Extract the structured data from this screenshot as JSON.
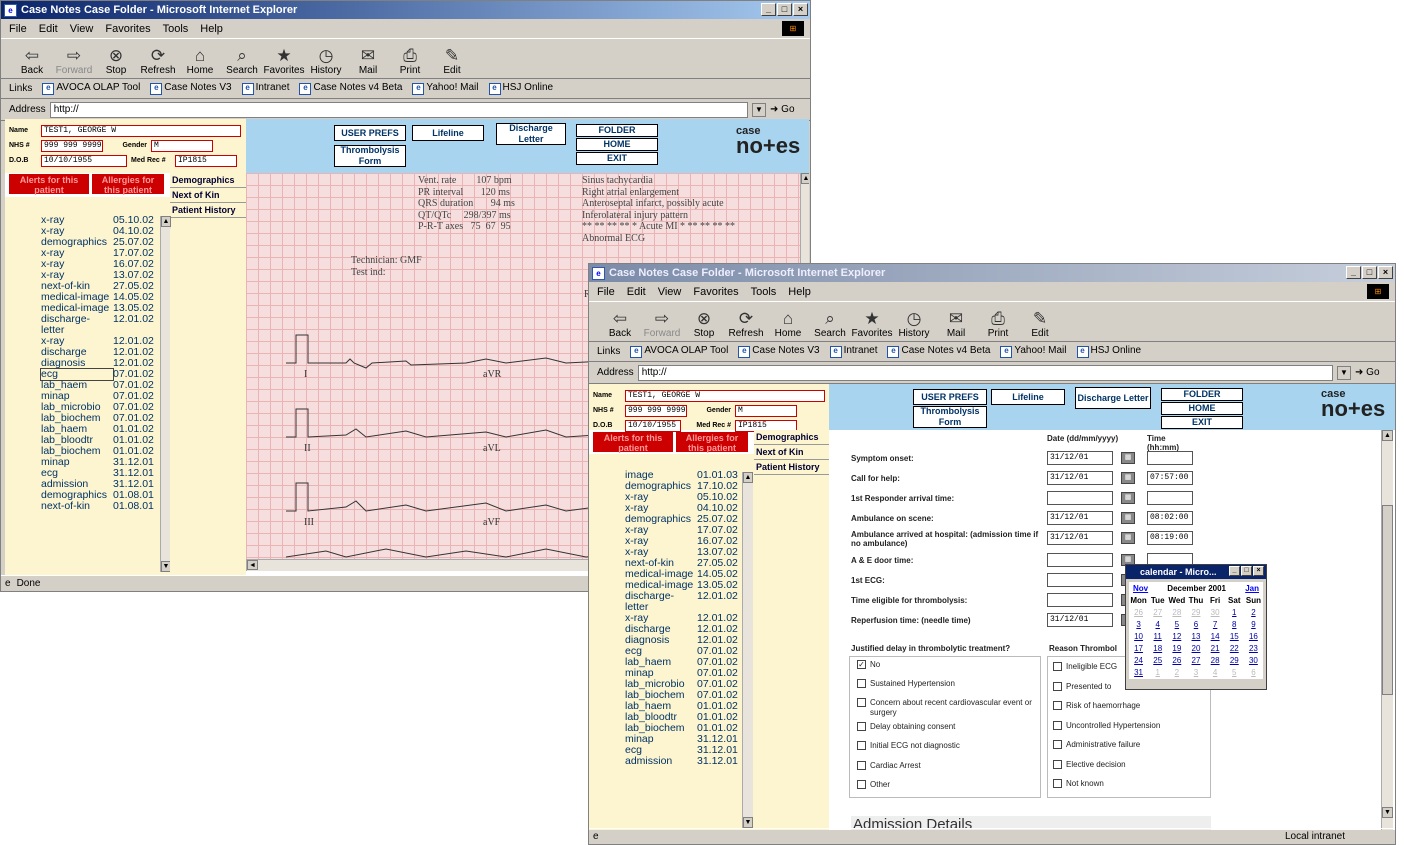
{
  "window1": {
    "title": "Case Notes Case Folder - Microsoft Internet Explorer",
    "menu": [
      "File",
      "Edit",
      "View",
      "Favorites",
      "Tools",
      "Help"
    ],
    "toolbar": [
      "Back",
      "Forward",
      "Stop",
      "Refresh",
      "Home",
      "Search",
      "Favorites",
      "History",
      "Mail",
      "Print",
      "Edit"
    ],
    "links_label": "Links",
    "links": [
      "AVOCA OLAP Tool",
      "Case Notes V3",
      "Intranet",
      "Case Notes v4 Beta",
      "Yahoo! Mail",
      "HSJ Online"
    ],
    "address_label": "Address",
    "address": "http://",
    "go": "Go",
    "status": "Done"
  },
  "window2": {
    "title": "Case Notes Case Folder - Microsoft Internet Explorer",
    "menu": [
      "File",
      "Edit",
      "View",
      "Favorites",
      "Tools",
      "Help"
    ],
    "toolbar": [
      "Back",
      "Forward",
      "Stop",
      "Refresh",
      "Home",
      "Search",
      "Favorites",
      "History",
      "Mail",
      "Print",
      "Edit"
    ],
    "links_label": "Links",
    "links": [
      "AVOCA OLAP Tool",
      "Case Notes V3",
      "Intranet",
      "Case Notes v4 Beta",
      "Yahoo! Mail",
      "HSJ Online"
    ],
    "address_label": "Address",
    "address": "http://",
    "go": "Go",
    "status_zone": "Local intranet"
  },
  "patient": {
    "name_label": "Name",
    "name": "TEST1, GEORGE W",
    "nhs_label": "NHS #",
    "nhs": "999 999 9999",
    "gender_label": "Gender",
    "gender": "M",
    "dob_label": "D.O.B",
    "dob": "10/10/1955",
    "medrec_label": "Med Rec #",
    "medrec": "IP1815"
  },
  "banner": {
    "user_prefs": "USER PREFS",
    "lifeline": "Lifeline",
    "discharge": "Discharge Letter",
    "thrombolysis": "Thrombolysis Form",
    "folder": "FOLDER",
    "home": "HOME",
    "exit": "EXIT",
    "logo_top": "case",
    "logo_bottom": "no+es"
  },
  "alerts": {
    "alerts": "Alerts for this patient",
    "allergies": "Allergies for this patient"
  },
  "tabs": [
    "Demographics",
    "Next of Kin",
    "Patient History"
  ],
  "history1": [
    [
      "x-ray",
      "05.10.02"
    ],
    [
      "x-ray",
      "04.10.02"
    ],
    [
      "demographics",
      "25.07.02"
    ],
    [
      "x-ray",
      "17.07.02"
    ],
    [
      "x-ray",
      "16.07.02"
    ],
    [
      "x-ray",
      "13.07.02"
    ],
    [
      "next-of-kin",
      "27.05.02"
    ],
    [
      "medical-image",
      "14.05.02"
    ],
    [
      "medical-image",
      "13.05.02"
    ],
    [
      "discharge-letter",
      "12.01.02"
    ],
    [
      "x-ray",
      "12.01.02"
    ],
    [
      "discharge",
      "12.01.02"
    ],
    [
      "diagnosis",
      "12.01.02"
    ],
    [
      "ecg",
      "07.01.02"
    ],
    [
      "lab_haem",
      "07.01.02"
    ],
    [
      "minap",
      "07.01.02"
    ],
    [
      "lab_microbio",
      "07.01.02"
    ],
    [
      "lab_biochem",
      "07.01.02"
    ],
    [
      "lab_haem",
      "01.01.02"
    ],
    [
      "lab_bloodtr",
      "01.01.02"
    ],
    [
      "lab_biochem",
      "01.01.02"
    ],
    [
      "minap",
      "31.12.01"
    ],
    [
      "ecg",
      "31.12.01"
    ],
    [
      "admission",
      "31.12.01"
    ],
    [
      "demographics",
      "01.08.01"
    ],
    [
      "next-of-kin",
      "01.08.01"
    ]
  ],
  "history2": [
    [
      "image",
      "01.01.03"
    ],
    [
      "demographics",
      "17.10.02"
    ],
    [
      "x-ray",
      "05.10.02"
    ],
    [
      "x-ray",
      "04.10.02"
    ],
    [
      "demographics",
      "25.07.02"
    ],
    [
      "x-ray",
      "17.07.02"
    ],
    [
      "x-ray",
      "16.07.02"
    ],
    [
      "x-ray",
      "13.07.02"
    ],
    [
      "next-of-kin",
      "27.05.02"
    ],
    [
      "medical-image",
      "14.05.02"
    ],
    [
      "medical-image",
      "13.05.02"
    ],
    [
      "discharge-letter",
      "12.01.02"
    ],
    [
      "x-ray",
      "12.01.02"
    ],
    [
      "discharge",
      "12.01.02"
    ],
    [
      "diagnosis",
      "12.01.02"
    ],
    [
      "ecg",
      "07.01.02"
    ],
    [
      "lab_haem",
      "07.01.02"
    ],
    [
      "minap",
      "07.01.02"
    ],
    [
      "lab_microbio",
      "07.01.02"
    ],
    [
      "lab_biochem",
      "07.01.02"
    ],
    [
      "lab_haem",
      "01.01.02"
    ],
    [
      "lab_bloodtr",
      "01.01.02"
    ],
    [
      "lab_biochem",
      "01.01.02"
    ],
    [
      "minap",
      "31.12.01"
    ],
    [
      "ecg",
      "31.12.01"
    ],
    [
      "admission",
      "31.12.01"
    ]
  ],
  "ecg": {
    "measures": "Vent. rate        107 bpm\nPR interval       120 ms\nQRS duration       94 ms\nQT/QTc     298/397 ms\nP-R-T axes   75  67  95",
    "interp": "Sinus tachycardia\nRight atrial enlargement\nAnteroseptal infarct, possibly acute\nInferolateral injury pattern\n** ** ** ** * Acute MI * ** ** ** **\nAbnormal ECG",
    "tech": "Technician: GMF\nTest ind:",
    "leads": [
      "I",
      "aVR",
      "II",
      "aVL",
      "III",
      "aVF",
      "R"
    ]
  },
  "form": {
    "date_header": "Date (dd/mm/yyyy)",
    "time_header": "Time (hh:mm)",
    "rows": [
      {
        "label": "Symptom onset:",
        "date": "31/12/01",
        "time": ""
      },
      {
        "label": "Call for help:",
        "date": "31/12/01",
        "time": "07:57:00"
      },
      {
        "label": "1st Responder arrival time:",
        "date": "",
        "time": ""
      },
      {
        "label": "Ambulance on scene:",
        "date": "31/12/01",
        "time": "08:02:00"
      },
      {
        "label": "Ambulance arrived at hospital: (admission time if no ambulance)",
        "date": "31/12/01",
        "time": "08:19:00"
      },
      {
        "label": "A & E door time:",
        "date": "",
        "time": ""
      },
      {
        "label": "1st ECG:",
        "date": "",
        "time": ""
      },
      {
        "label": "Time eligible for thrombolysis:",
        "date": "",
        "time": ""
      },
      {
        "label": "Reperfusion time: (needle time)",
        "date": "31/12/01",
        "time": ""
      }
    ],
    "justified_q": "Justified delay in thrombolytic treatment?",
    "reason_q": "Reason Thrombol",
    "left_opts": [
      [
        "No",
        true
      ],
      [
        "Sustained Hypertension",
        false
      ],
      [
        "Concern about recent cardiovascular event or surgery",
        false
      ],
      [
        "Delay obtaining consent",
        false
      ],
      [
        "Initial ECG not diagnostic",
        false
      ],
      [
        "Cardiac Arrest",
        false
      ],
      [
        "Other",
        false
      ]
    ],
    "right_opts": [
      "Ineligible ECG",
      "Presented to",
      "Risk of haemorrhage",
      "Uncontrolled Hypertension",
      "Administrative failure",
      "Elective decision",
      "Not known"
    ],
    "admission_details": "Admission Details"
  },
  "calendar": {
    "title": "calendar - Micro...",
    "prev": "Nov",
    "month": "December 2001",
    "next": "Jan",
    "days": [
      "Mon",
      "Tue",
      "Wed",
      "Thu",
      "Fri",
      "Sat",
      "Sun"
    ],
    "weeks": [
      [
        "26",
        "27",
        "28",
        "29",
        "30",
        "1",
        "2"
      ],
      [
        "3",
        "4",
        "5",
        "6",
        "7",
        "8",
        "9"
      ],
      [
        "10",
        "11",
        "12",
        "13",
        "14",
        "15",
        "16"
      ],
      [
        "17",
        "18",
        "19",
        "20",
        "21",
        "22",
        "23"
      ],
      [
        "24",
        "25",
        "26",
        "27",
        "28",
        "29",
        "30"
      ],
      [
        "31",
        "1",
        "2",
        "3",
        "4",
        "5",
        "6"
      ]
    ]
  }
}
